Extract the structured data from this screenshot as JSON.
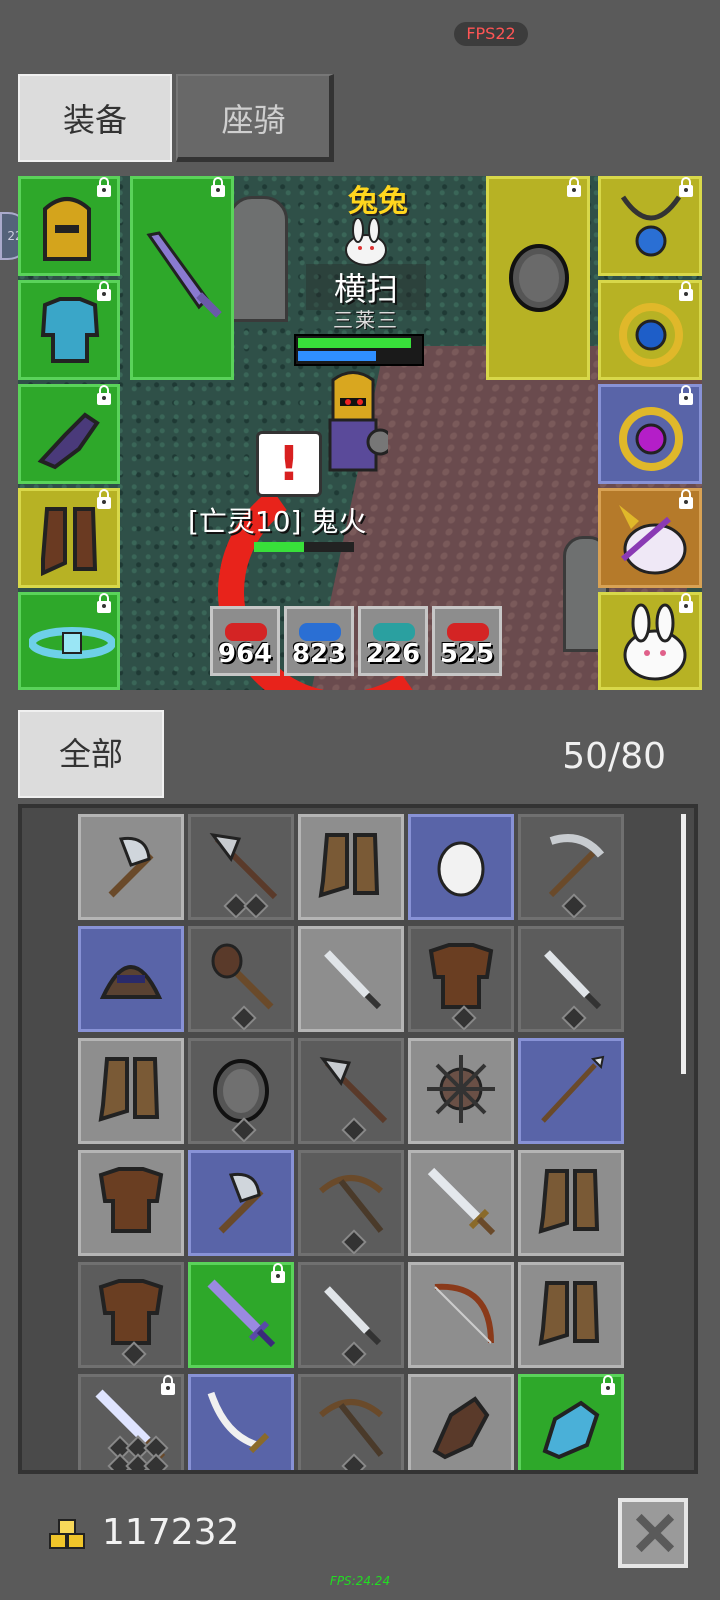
{
  "fps_top": "FPS22",
  "tabs": {
    "equip": "装备",
    "mount": "座骑"
  },
  "side_badge": "22",
  "scene": {
    "pet_name": "兔兔",
    "skill_name": "横扫",
    "skill_sub": "三莱三",
    "enemy_label": "[亡灵10] 鬼火",
    "hp_fraction": 0.96,
    "mp_fraction": 0.66,
    "enemy_hp_fraction": 0.5
  },
  "potions": [
    {
      "count": "964",
      "color": "#d42424"
    },
    {
      "count": "823",
      "color": "#2a6fd4"
    },
    {
      "count": "226",
      "color": "#2aa0a0"
    },
    {
      "count": "525",
      "color": "#d42424"
    }
  ],
  "equip_slots_left": [
    {
      "name": "helmet",
      "rarity": "green",
      "locked": true
    },
    {
      "name": "armor",
      "rarity": "green",
      "locked": true
    },
    {
      "name": "gloves",
      "rarity": "green",
      "locked": true
    },
    {
      "name": "boots",
      "rarity": "yellow",
      "locked": true
    },
    {
      "name": "belt",
      "rarity": "green",
      "locked": true
    }
  ],
  "equip_weapon": {
    "name": "sword",
    "rarity": "green",
    "locked": true
  },
  "equip_shield": {
    "name": "shield",
    "rarity": "yellow",
    "locked": true
  },
  "equip_slots_right": [
    {
      "name": "necklace",
      "rarity": "yellow",
      "locked": true
    },
    {
      "name": "ring-blue",
      "rarity": "yellow",
      "locked": true
    },
    {
      "name": "ring-purple",
      "rarity": "blue",
      "locked": true
    },
    {
      "name": "pet-unicorn",
      "rarity": "orange",
      "locked": true
    },
    {
      "name": "pet-rabbit",
      "rarity": "yellow",
      "locked": true
    }
  ],
  "inventory": {
    "filter_label": "全部",
    "count": "50/80",
    "items": [
      {
        "icon": "axe-icon",
        "bg": "grey",
        "diamonds": 0,
        "locked": false
      },
      {
        "icon": "halberd-icon",
        "bg": "dark",
        "diamonds": 2,
        "locked": false
      },
      {
        "icon": "boots-icon",
        "bg": "grey",
        "diamonds": 0,
        "locked": false
      },
      {
        "icon": "egg-icon",
        "bg": "blue",
        "diamonds": 0,
        "locked": false
      },
      {
        "icon": "pickaxe-icon",
        "bg": "dark",
        "diamonds": 1,
        "locked": false
      },
      {
        "icon": "hood-icon",
        "bg": "blue",
        "diamonds": 0,
        "locked": false
      },
      {
        "icon": "mace-icon",
        "bg": "dark",
        "diamonds": 1,
        "locked": false
      },
      {
        "icon": "dagger-icon",
        "bg": "grey",
        "diamonds": 0,
        "locked": false
      },
      {
        "icon": "chest-armor-icon",
        "bg": "dark",
        "diamonds": 1,
        "locked": false
      },
      {
        "icon": "dagger-icon",
        "bg": "dark",
        "diamonds": 1,
        "locked": false
      },
      {
        "icon": "boots-icon",
        "bg": "grey",
        "diamonds": 0,
        "locked": false
      },
      {
        "icon": "shield-icon",
        "bg": "dark",
        "diamonds": 1,
        "locked": false
      },
      {
        "icon": "halberd-icon",
        "bg": "dark",
        "diamonds": 1,
        "locked": false
      },
      {
        "icon": "spiked-ball-icon",
        "bg": "grey",
        "diamonds": 0,
        "locked": false
      },
      {
        "icon": "spear-icon",
        "bg": "blue",
        "diamonds": 0,
        "locked": false
      },
      {
        "icon": "chest-armor-icon",
        "bg": "grey",
        "diamonds": 0,
        "locked": false
      },
      {
        "icon": "axe-icon",
        "bg": "blue",
        "diamonds": 0,
        "locked": false
      },
      {
        "icon": "crossbow-icon",
        "bg": "dark",
        "diamonds": 1,
        "locked": false
      },
      {
        "icon": "sword-icon",
        "bg": "grey",
        "diamonds": 0,
        "locked": false
      },
      {
        "icon": "boots-icon",
        "bg": "grey",
        "diamonds": 0,
        "locked": false
      },
      {
        "icon": "chest-armor-icon",
        "bg": "dark",
        "diamonds": 1,
        "locked": false
      },
      {
        "icon": "purple-sword-icon",
        "bg": "green",
        "diamonds": 0,
        "locked": true
      },
      {
        "icon": "dagger-icon",
        "bg": "dark",
        "diamonds": 1,
        "locked": false
      },
      {
        "icon": "bow-icon",
        "bg": "grey",
        "diamonds": 0,
        "locked": false
      },
      {
        "icon": "boots-icon",
        "bg": "grey",
        "diamonds": 0,
        "locked": false
      },
      {
        "icon": "crystal-sword-icon",
        "bg": "dark",
        "diamonds": 6,
        "locked": true
      },
      {
        "icon": "sabre-icon",
        "bg": "blue",
        "diamonds": 0,
        "locked": false
      },
      {
        "icon": "crossbow-icon",
        "bg": "dark",
        "diamonds": 1,
        "locked": false
      },
      {
        "icon": "glove-icon",
        "bg": "grey",
        "diamonds": 0,
        "locked": false
      },
      {
        "icon": "gauntlet-icon",
        "bg": "green",
        "diamonds": 0,
        "locked": true
      }
    ]
  },
  "gold": "117232",
  "fps_bottom": "FPS:24.24"
}
